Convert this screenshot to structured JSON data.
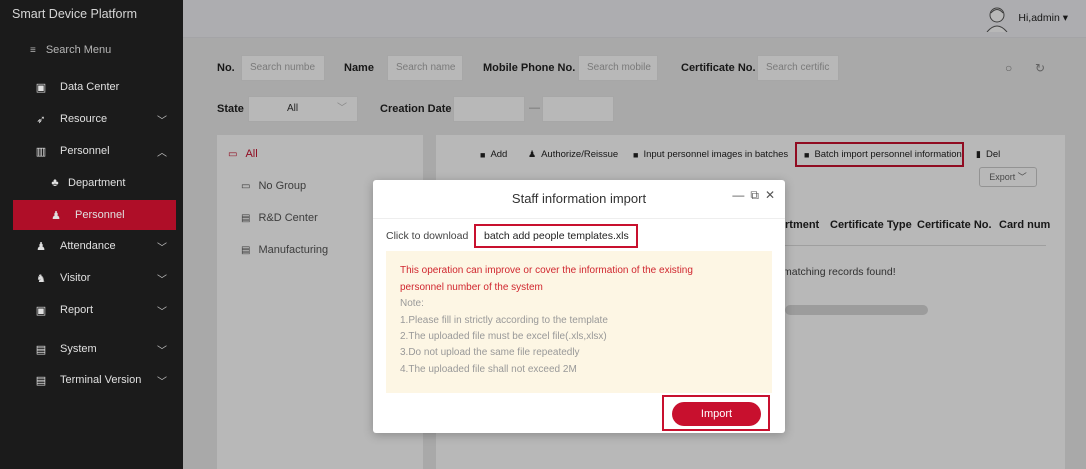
{
  "app": {
    "title": "Smart Device Platform"
  },
  "sidebar": {
    "search": "Search Menu",
    "items": [
      {
        "label": "Data Center"
      },
      {
        "label": "Resource"
      },
      {
        "label": "Personnel"
      },
      {
        "label": "Department"
      },
      {
        "label": "Personnel"
      },
      {
        "label": "Attendance"
      },
      {
        "label": "Visitor"
      },
      {
        "label": "Report"
      },
      {
        "label": "System"
      },
      {
        "label": "Terminal Version"
      }
    ]
  },
  "header": {
    "greeting": "Hi,admin ▾"
  },
  "filters": {
    "no_label": "No.",
    "no_placeholder": "Search numbe",
    "name_label": "Name",
    "name_placeholder": "Search name",
    "mobile_label": "Mobile Phone No.",
    "mobile_placeholder": "Search mobile",
    "cert_label": "Certificate No.",
    "cert_placeholder": "Search certific",
    "state_label": "State",
    "state_value": "All",
    "creation_label": "Creation Date",
    "date_sep": "—"
  },
  "tree": {
    "items": [
      {
        "label": "All"
      },
      {
        "label": "No Group"
      },
      {
        "label": "R&D Center"
      },
      {
        "label": "Manufacturing"
      }
    ]
  },
  "toolbar": {
    "add": "Add",
    "authorize": "Authorize/Reissue",
    "input_images": "Input personnel images in batches",
    "batch_import": "Batch import personnel information",
    "del": "Del",
    "export": "Export"
  },
  "table": {
    "headers": [
      "rtment",
      "Certificate Type",
      "Certificate No.",
      "Card num"
    ],
    "empty": "matching records found!"
  },
  "modal": {
    "title": "Staff information import",
    "download_label": "Click to download",
    "download_link": "batch add people templates.xls",
    "notice_red": [
      "This operation can improve or cover the information of the existing",
      "personnel number of the system"
    ],
    "notice_grey": [
      "Note:",
      "1.Please fill in strictly according to the template",
      "2.The uploaded file must be excel file(.xls,xlsx)",
      "3.Do not upload the same file repeatedly",
      "4.The uploaded file shall not exceed 2M"
    ],
    "import_button": "Import"
  },
  "colors": {
    "accent": "#c8102e",
    "sidebar": "#1f1f1f",
    "notice_bg": "#fdf6e4"
  }
}
